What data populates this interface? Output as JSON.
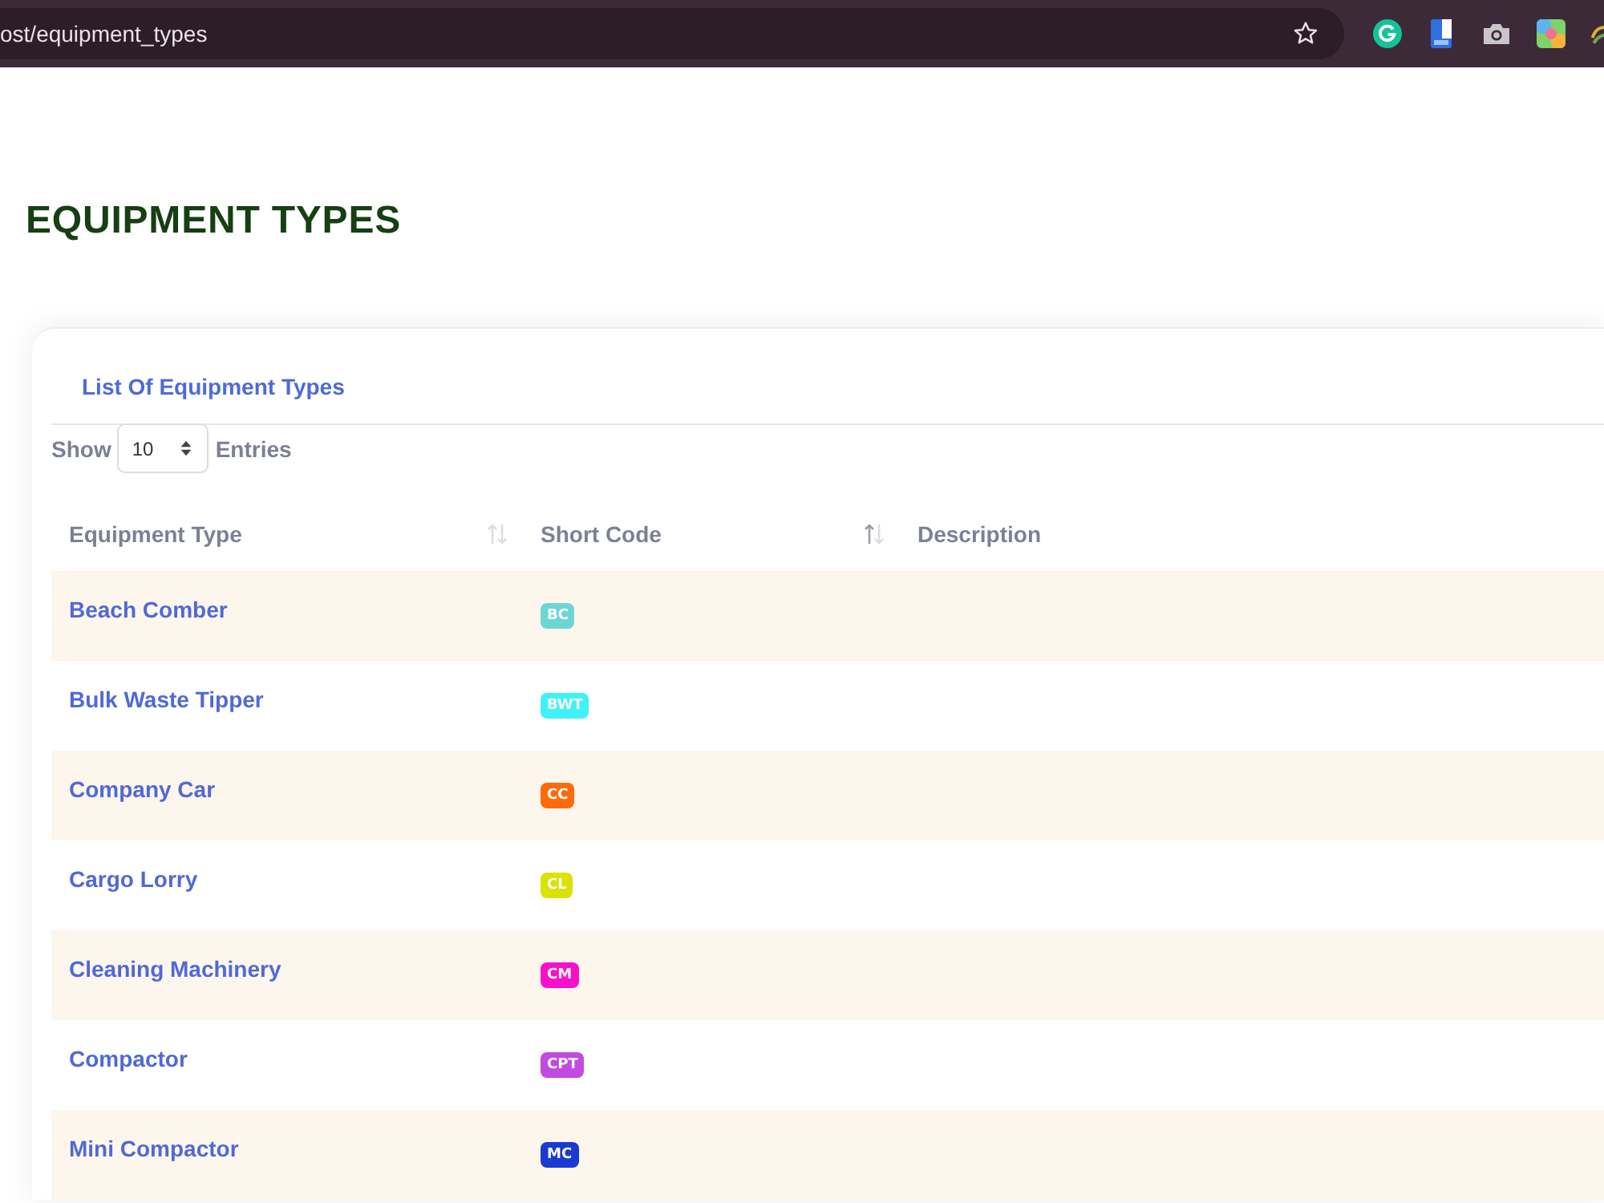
{
  "browser": {
    "url": "ost/equipment_types"
  },
  "page": {
    "title": "EQUIPMENT TYPES"
  },
  "card": {
    "title": "List Of Equipment Types",
    "length_control": {
      "before": "Show",
      "value": "10",
      "after": "Entries"
    }
  },
  "table": {
    "columns": [
      {
        "label": "Equipment Type",
        "sorted": false
      },
      {
        "label": "Short Code",
        "sorted": true
      },
      {
        "label": "Description"
      }
    ],
    "rows": [
      {
        "name": "Beach Comber",
        "code": "BC",
        "color": "#6dd6d2"
      },
      {
        "name": "Bulk Waste Tipper",
        "code": "BWT",
        "color": "#3ef2f7"
      },
      {
        "name": "Company Car",
        "code": "CC",
        "color": "#ff6a0a"
      },
      {
        "name": "Cargo Lorry",
        "code": "CL",
        "color": "#dbe205"
      },
      {
        "name": "Cleaning Machinery",
        "code": "CM",
        "color": "#f70fc9"
      },
      {
        "name": "Compactor",
        "code": "CPT",
        "color": "#c04ae2"
      },
      {
        "name": "Mini Compactor",
        "code": "MC",
        "color": "#1b3ad2"
      }
    ]
  }
}
